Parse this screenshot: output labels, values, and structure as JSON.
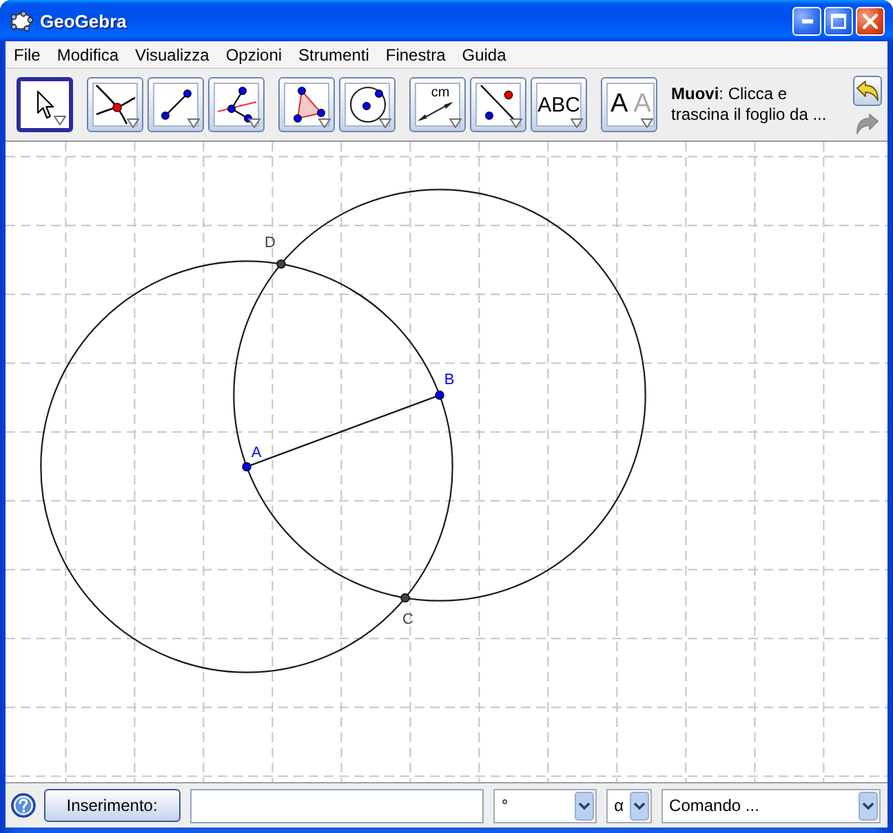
{
  "window": {
    "title": "GeoGebra"
  },
  "menu": [
    "File",
    "Modifica",
    "Visualizza",
    "Opzioni",
    "Strumenti",
    "Finestra",
    "Guida"
  ],
  "toolbar": {
    "groups": [
      {
        "tools": [
          {
            "kind": "move",
            "selected": true
          }
        ]
      },
      {
        "tools": [
          {
            "kind": "intersect",
            "selected": false
          },
          {
            "kind": "segment",
            "selected": false
          },
          {
            "kind": "bisector",
            "selected": false
          }
        ]
      },
      {
        "tools": [
          {
            "kind": "polygon",
            "selected": false
          },
          {
            "kind": "circle",
            "selected": false
          }
        ]
      },
      {
        "tools": [
          {
            "kind": "distance",
            "selected": false,
            "text": "cm"
          },
          {
            "kind": "reflect",
            "selected": false
          },
          {
            "kind": "text",
            "selected": false,
            "text": "ABC"
          }
        ]
      },
      {
        "tools": [
          {
            "kind": "style",
            "selected": false,
            "letters": [
              "A",
              "A"
            ]
          }
        ]
      }
    ],
    "help": "**Muovi**: Clicca e trascina il foglio da ...",
    "history": [
      {
        "kind": "undo",
        "disabled": false
      },
      {
        "kind": "redo",
        "disabled": true
      }
    ]
  },
  "canvas": {
    "points": [
      {
        "label": "D",
        "color": "#404040"
      },
      {
        "label": "B",
        "color": "#0000ff"
      },
      {
        "label": "A",
        "color": "#0000ff"
      },
      {
        "label": "C",
        "color": "#404040"
      }
    ]
  },
  "input_bar": {
    "button": "Inserimento:",
    "unit": "°",
    "symbol": "α",
    "command": "Comando ..."
  }
}
